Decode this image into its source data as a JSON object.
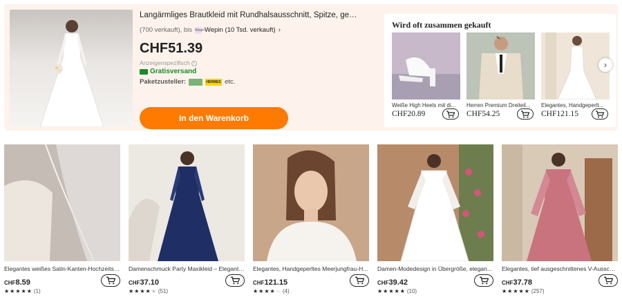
{
  "product": {
    "title": "Langärmliges Brautkleid mit Rundhalsausschnitt, Spitze, gespleißte...",
    "sold": "(700 verkauft), bis",
    "store_logo": "Wepin",
    "store": "Wepin (10 Tsd. verkauft)",
    "price": "CHF51.39",
    "estimate": "Anzeigenspezifisch",
    "shipping": "Gratisversand",
    "carrier_label": "Paketzusteller:",
    "carrier_badge": "HERMES",
    "carrier_more": "etc.",
    "cart_button": "In den Warenkorb"
  },
  "fbt": {
    "title": "Wird oft zusammen gekauft",
    "items": [
      {
        "name": "Weiße High Heels mit di...",
        "price": "CHF20.89"
      },
      {
        "name": "Herren Premium Dreiteil...",
        "price": "CHF54.25"
      },
      {
        "name": "Elegantes, Handgeperlt...",
        "price": "CHF121.15"
      }
    ],
    "next_icon": "chevron-right-icon"
  },
  "grid": [
    {
      "name": "Elegantes weißes Satin-Kanten-Hochzeits-...",
      "currency": "CHF",
      "amount": "8.59",
      "rating": 5,
      "count": "(1)"
    },
    {
      "name": "Damenschmuck Party Maxikleid – Elegante...",
      "currency": "CHF",
      "amount": "37.10",
      "rating": 4.5,
      "count": "(51)"
    },
    {
      "name": "Elegantes, Handgeperltes Meerjungfrau-H...",
      "currency": "CHF",
      "amount": "121.15",
      "rating": 4,
      "count": "(4)"
    },
    {
      "name": "Damen-Modedesign in Übergröße, elegan...",
      "currency": "CHF",
      "amount": "39.42",
      "rating": 5,
      "count": "(10)"
    },
    {
      "name": "Elegantes, tief ausgeschnittenes V-Ausschn...",
      "currency": "CHF",
      "amount": "37.78",
      "rating": 5,
      "count": "(257)"
    }
  ],
  "colors": {
    "accent": "#fe7a00",
    "panel_bg": "#fdf3ec",
    "shipping_green": "#1a8a2a"
  }
}
